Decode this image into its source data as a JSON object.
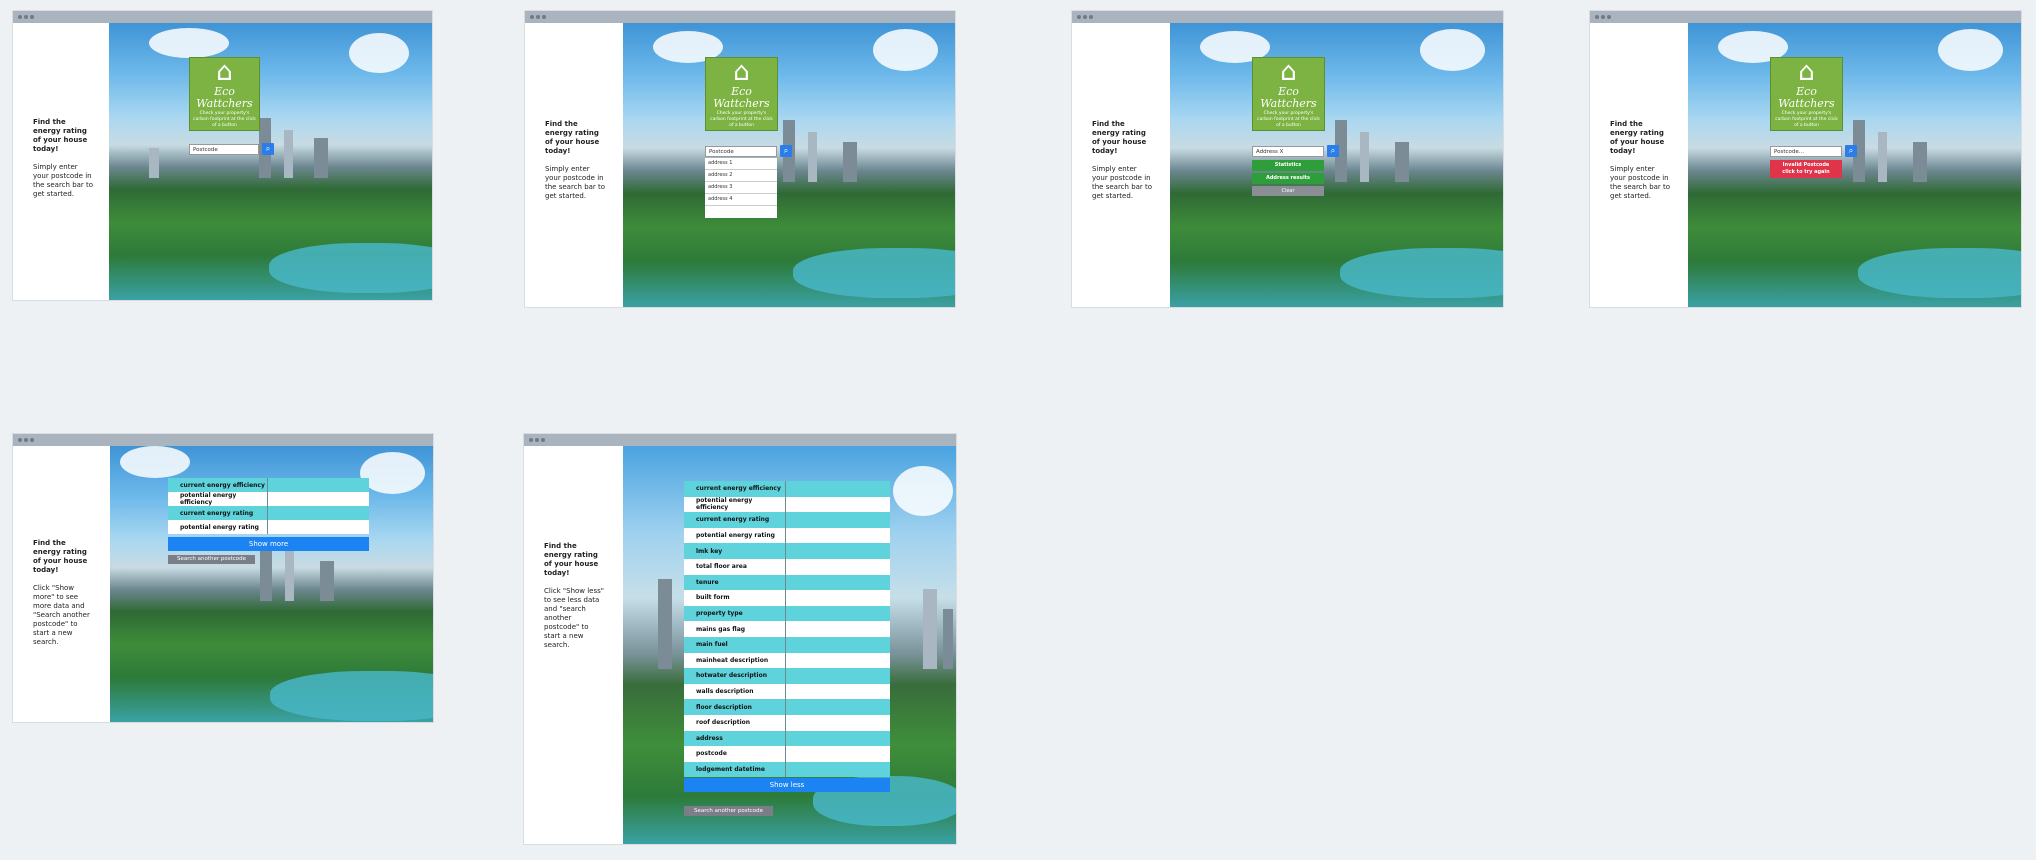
{
  "app": {
    "logo_name": "Eco Wattchers",
    "logo_tagline": "Check your property's carbon footprint at the click of a button",
    "heading": "Find the energy rating of your house today!",
    "intro": "Simply enter your postcode in the search bar to get started."
  },
  "search": {
    "placeholder": "Postcode",
    "placeholder_invalid": "Postcode..."
  },
  "dropdown": [
    "address 1",
    "address 2",
    "address 3",
    "address 4"
  ],
  "selected_address": "Address X",
  "actions": {
    "statistics": "Statistics",
    "address_results": "Address results",
    "clear": "Clear"
  },
  "error": {
    "line1": "Invalid Postcode",
    "line2": "click to try again"
  },
  "results_short": {
    "intro": "Click \"Show more\" to see more data and \"Search another postcode\" to start a new search.",
    "rows": [
      "current energy efficiency",
      "potential energy efficiency",
      "current energy rating",
      "potential energy rating"
    ],
    "show_more": "Show more",
    "search_another": "Search another postcode"
  },
  "results_long": {
    "intro": "Click \"Show less\" to see less data and \"search another postcode\" to start a new search.",
    "rows": [
      "current energy efficiency",
      "potential energy efficiency",
      "current energy rating",
      "potential energy rating",
      "lmk key",
      "total floor area",
      "tenure",
      "built form",
      "property type",
      "mains gas flag",
      "main fuel",
      "mainheat description",
      "hotwater description",
      "walls description",
      "floor description",
      "roof description",
      "address",
      "postcode",
      "lodgement datetime"
    ],
    "show_less": "Show less",
    "search_another": "Search another postcode"
  },
  "colors": {
    "logo_green": "#7cb342",
    "search_blue": "#2b7de9",
    "stat_green": "#2e9e3a",
    "error_red": "#e0344a",
    "row_teal": "#5fd3dc",
    "show_blue": "#1b84f2"
  }
}
